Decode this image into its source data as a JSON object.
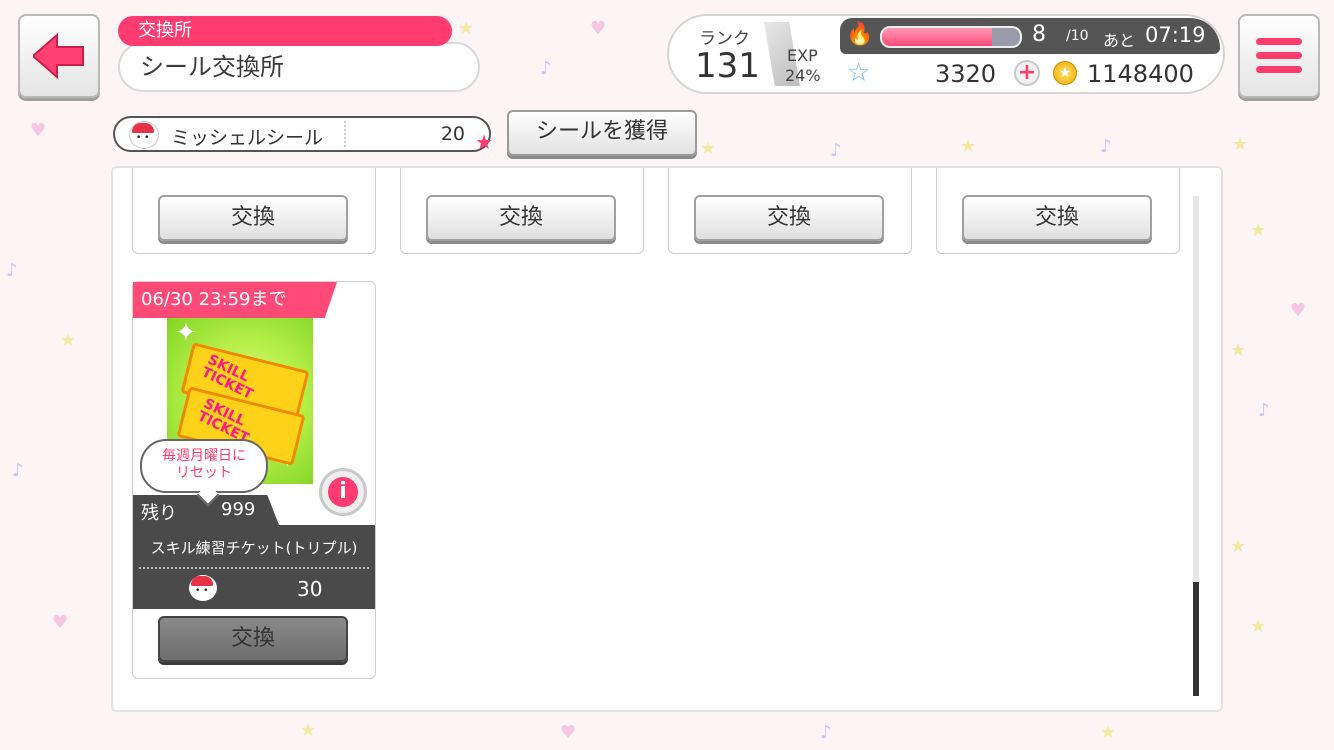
{
  "header": {
    "subtitle": "交換所",
    "title": "シール交換所"
  },
  "status": {
    "rank_label": "ランク",
    "rank_value": "131",
    "exp_label": "EXP",
    "exp_value": "24%",
    "stamina_current": "8",
    "stamina_max": "/10",
    "stamina_fraction": 0.8,
    "stamina_remaining_label": "あと",
    "stamina_timer": "07:19",
    "star_gems": "3320",
    "coins": "1148400"
  },
  "seal": {
    "name": "ミッシェルシール",
    "count": "20",
    "get_button": "シールを獲得"
  },
  "top_row_buttons": [
    "交換",
    "交換",
    "交換",
    "交換"
  ],
  "item": {
    "deadline": "06/30 23:59まで",
    "image_text_1": "SKILL\nTICKET",
    "image_text_2": "SKILL\nTICKET",
    "reset_note_line1": "毎週月曜日に",
    "reset_note_line2": "リセット",
    "remaining_label": "残り",
    "remaining_value": "999",
    "name": "スキル練習チケット(トリプル)",
    "cost": "30",
    "exchange_button": "交換"
  },
  "colors": {
    "accent": "#ff3b6f",
    "dark_panel": "#4a4a4a"
  },
  "icons": {
    "back": "arrow-left-icon",
    "menu": "hamburger-icon",
    "stamina": "fire-icon",
    "gem": "star-icon",
    "coin": "coin-icon",
    "info": "info-icon"
  }
}
